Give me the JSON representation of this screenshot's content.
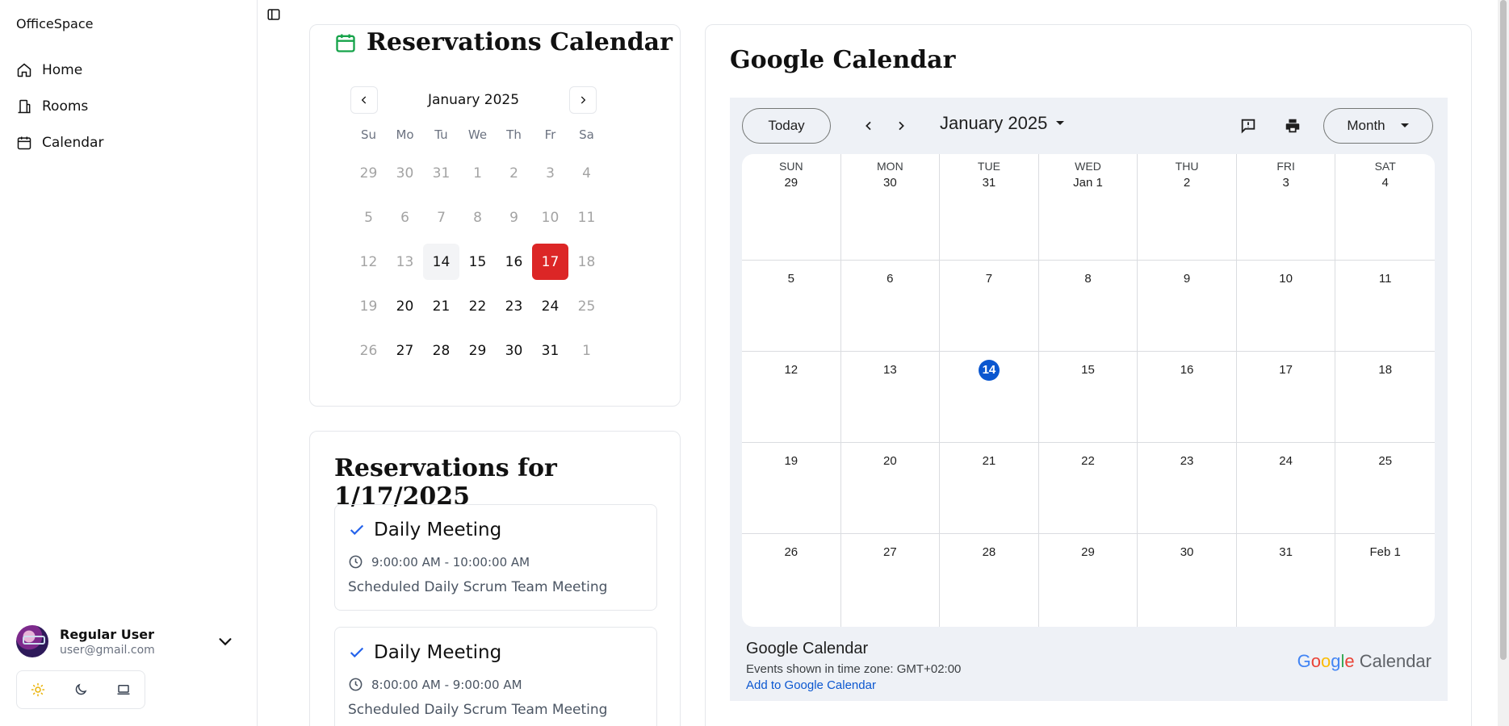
{
  "sidebar": {
    "app_title": "OfficeSpace",
    "nav": [
      {
        "label": "Home",
        "icon": "home-icon"
      },
      {
        "label": "Rooms",
        "icon": "building-icon"
      },
      {
        "label": "Calendar",
        "icon": "calendar-icon"
      }
    ],
    "user": {
      "name": "Regular User",
      "email": "user@gmail.com"
    },
    "theme_options": [
      "light-theme-icon",
      "dark-theme-icon",
      "system-theme-icon"
    ]
  },
  "reservations_calendar": {
    "title": "Reservations Calendar",
    "month_label": "January 2025",
    "weekdays": [
      "Su",
      "Mo",
      "Tu",
      "We",
      "Th",
      "Fr",
      "Sa"
    ],
    "weeks": [
      [
        {
          "d": "29",
          "m": true
        },
        {
          "d": "30",
          "m": true
        },
        {
          "d": "31",
          "m": true
        },
        {
          "d": "1",
          "m": true
        },
        {
          "d": "2",
          "m": true
        },
        {
          "d": "3",
          "m": true
        },
        {
          "d": "4",
          "m": true
        }
      ],
      [
        {
          "d": "5",
          "m": true
        },
        {
          "d": "6",
          "m": true
        },
        {
          "d": "7",
          "m": true
        },
        {
          "d": "8",
          "m": true
        },
        {
          "d": "9",
          "m": true
        },
        {
          "d": "10",
          "m": true
        },
        {
          "d": "11",
          "m": true
        }
      ],
      [
        {
          "d": "12",
          "m": true
        },
        {
          "d": "13",
          "m": true
        },
        {
          "d": "14",
          "t": true
        },
        {
          "d": "15"
        },
        {
          "d": "16"
        },
        {
          "d": "17",
          "s": true
        },
        {
          "d": "18",
          "m": true
        }
      ],
      [
        {
          "d": "19",
          "m": true
        },
        {
          "d": "20"
        },
        {
          "d": "21"
        },
        {
          "d": "22"
        },
        {
          "d": "23"
        },
        {
          "d": "24"
        },
        {
          "d": "25",
          "m": true
        }
      ],
      [
        {
          "d": "26",
          "m": true
        },
        {
          "d": "27"
        },
        {
          "d": "28"
        },
        {
          "d": "29"
        },
        {
          "d": "30"
        },
        {
          "d": "31"
        },
        {
          "d": "1",
          "m": true
        }
      ]
    ],
    "accent_color": "#dc2626",
    "icon_color": "#16a34a"
  },
  "reservations_list": {
    "title": "Reservations for 1/17/2025",
    "items": [
      {
        "title": "Daily Meeting",
        "time": "9:00:00 AM - 10:00:00 AM",
        "description": "Scheduled Daily Scrum Team Meeting"
      },
      {
        "title": "Daily Meeting",
        "time": "8:00:00 AM - 9:00:00 AM",
        "description": "Scheduled Daily Scrum Team Meeting"
      }
    ]
  },
  "google_calendar": {
    "heading": "Google Calendar",
    "today_label": "Today",
    "month_label": "January 2025",
    "view_label": "Month",
    "weekday_headers": [
      "SUN",
      "MON",
      "TUE",
      "WED",
      "THU",
      "FRI",
      "SAT"
    ],
    "weeks": [
      [
        "29",
        "30",
        "31",
        "Jan 1",
        "2",
        "3",
        "4"
      ],
      [
        "5",
        "6",
        "7",
        "8",
        "9",
        "10",
        "11"
      ],
      [
        "12",
        "13",
        "14",
        "15",
        "16",
        "17",
        "18"
      ],
      [
        "19",
        "20",
        "21",
        "22",
        "23",
        "24",
        "25"
      ],
      [
        "26",
        "27",
        "28",
        "29",
        "30",
        "31",
        "Feb 1"
      ]
    ],
    "today_date": "14",
    "footer_title": "Google Calendar",
    "timezone_text": "Events shown in time zone: GMT+02:00",
    "add_link": "Add to Google Calendar",
    "logo_word": "Google",
    "logo_suffix": "Calendar",
    "today_color": "#0b57d0"
  }
}
